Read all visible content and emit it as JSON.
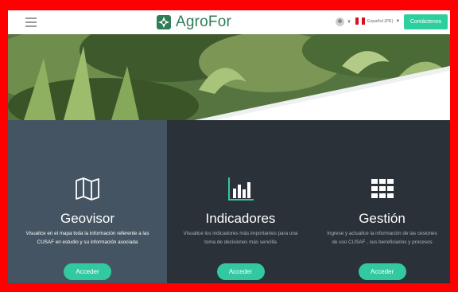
{
  "header": {
    "menu_icon": "hamburger-menu-icon",
    "brand_name": "AgroFor",
    "brand_color": "#2f7d57",
    "language_label": "Español (PE)",
    "contact_label": "Contáctenos",
    "accent_color": "#2ecf9e"
  },
  "features": [
    {
      "title": "Geovisor",
      "icon": "map-icon",
      "description": "Visualice en el mapa toda la información referente a las CUSAF en estudio y su información asociada",
      "button_label": "Acceder"
    },
    {
      "title": "Indicadores",
      "icon": "bar-chart-icon",
      "description": "Visualice los indicadores más importantes para una toma de decisiones más sencilla",
      "button_label": "Acceder"
    },
    {
      "title": "Gestión",
      "icon": "grid-icon",
      "description": "Ingrese y actualice la información de las cesiones de uso CUSAF , sus beneficiarios y procesos",
      "button_label": "Acceder"
    }
  ]
}
